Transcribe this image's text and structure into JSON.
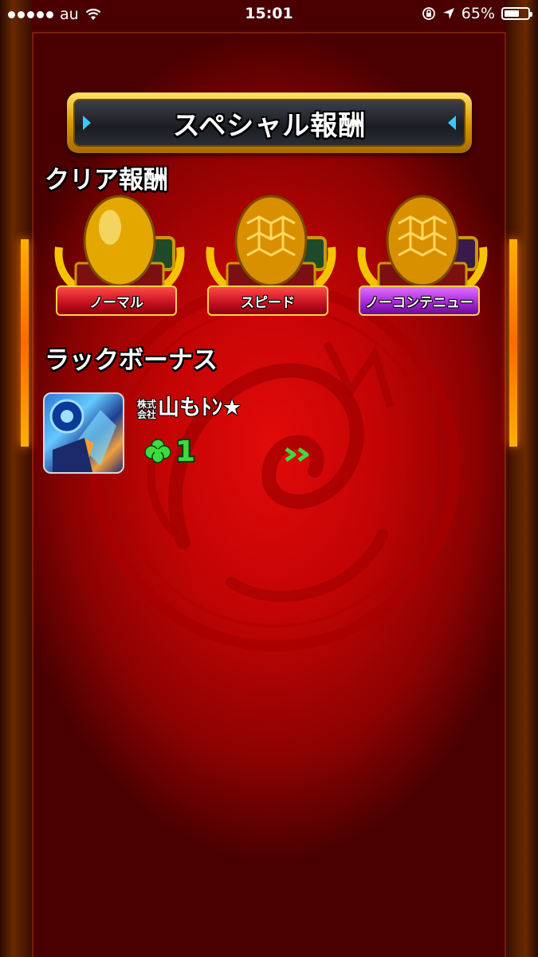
{
  "status_bar": {
    "carrier": "au",
    "time": "15:01",
    "battery": "65%",
    "battery_level": 0.65,
    "icons": [
      "signal-dots-icon",
      "wifi-icon",
      "rotation-lock-icon",
      "location-arrow-icon",
      "battery-icon"
    ]
  },
  "banner": {
    "title": "スペシャル報酬"
  },
  "clear_reward": {
    "heading": "クリア報酬",
    "items": [
      {
        "label": "ノーマル",
        "egg": "gold-egg",
        "ribbon_color": "#c40f1e"
      },
      {
        "label": "スピード",
        "egg": "gold-hex-egg",
        "ribbon_color": "#c40f1e"
      },
      {
        "label": "ノーコンテニュー",
        "egg": "gold-hex-egg",
        "ribbon_color": "#a524d6"
      }
    ]
  },
  "luck_bonus": {
    "heading": "ラックボーナス",
    "company_prefix_top": "株式",
    "company_prefix_bottom": "会社",
    "player_name": "山もﾄﾝ★",
    "luck_value": "1",
    "icons": [
      "clover-icon",
      "double-chevron-right-icon"
    ]
  },
  "colors": {
    "background_red": "#c30404",
    "frame_gold": "#d99a00",
    "luck_green": "#3ddc3d",
    "banner_arrow": "#39c9ff"
  }
}
